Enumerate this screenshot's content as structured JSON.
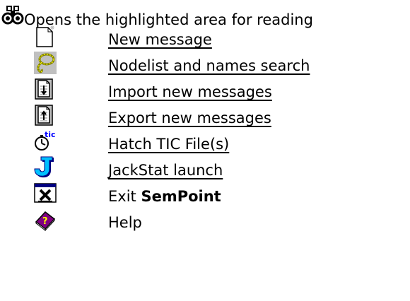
{
  "header": {
    "text": "Opens the highlighted area for reading",
    "icon": "binoculars-icon"
  },
  "items": [
    {
      "label": "New message",
      "icon": "new-document-icon",
      "link": true
    },
    {
      "label": "Nodelist and names search",
      "icon": "lasso-search-icon",
      "link": true
    },
    {
      "label": "Import new messages",
      "icon": "import-document-icon",
      "link": true
    },
    {
      "label": "Export new messages",
      "icon": "export-document-icon",
      "link": true
    },
    {
      "label": "Hatch TIC File(s)",
      "icon": "tic-stopwatch-icon",
      "link": true
    },
    {
      "label": "JackStat launch",
      "icon": "jackstat-j-icon",
      "link": true
    },
    {
      "label_prefix": "Exit ",
      "label_bold": "SemPoint",
      "icon": "exit-window-icon",
      "link": false
    },
    {
      "label": "Help",
      "icon": "help-book-icon",
      "link": false
    }
  ]
}
